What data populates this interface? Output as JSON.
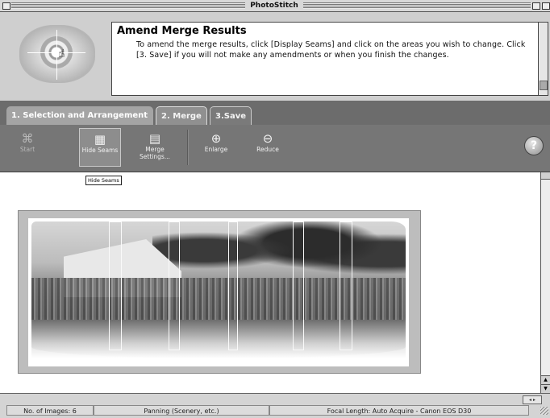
{
  "window": {
    "title": "PhotoStitch"
  },
  "header": {
    "title": "Amend Merge Results",
    "instructions": "To amend the merge results, click [Display Seams] and click on the areas you wish to change. Click [3. Save] if you will not make any amendments or when you finish the changes."
  },
  "tabs": [
    {
      "label": "1. Selection and Arrangement"
    },
    {
      "label": "2. Merge"
    },
    {
      "label": "3.Save"
    }
  ],
  "active_tab": "2. Merge",
  "toolbar": {
    "start_label": "Start",
    "hide_seams_label": "Hide Seams",
    "merge_settings_label": "Merge Settings...",
    "enlarge_label": "Enlarge",
    "reduce_label": "Reduce",
    "help_label": "?"
  },
  "tooltip": {
    "text": "Hide Seams"
  },
  "icons": {
    "start": "start-icon",
    "hide_seams": "grid-icon",
    "merge_settings": "settings-icon",
    "enlarge": "zoom-in-icon",
    "reduce": "zoom-out-icon",
    "help": "help-icon"
  },
  "status": {
    "images": "No. of Images: 6",
    "mode": "Panning (Scenery, etc.)",
    "focal_length": "Focal Length: Auto Acquire - Canon EOS D30"
  },
  "colors": {
    "tab_bar": "#6c6c6c",
    "toolbar": "#767676",
    "canvas": "#ffffff"
  }
}
